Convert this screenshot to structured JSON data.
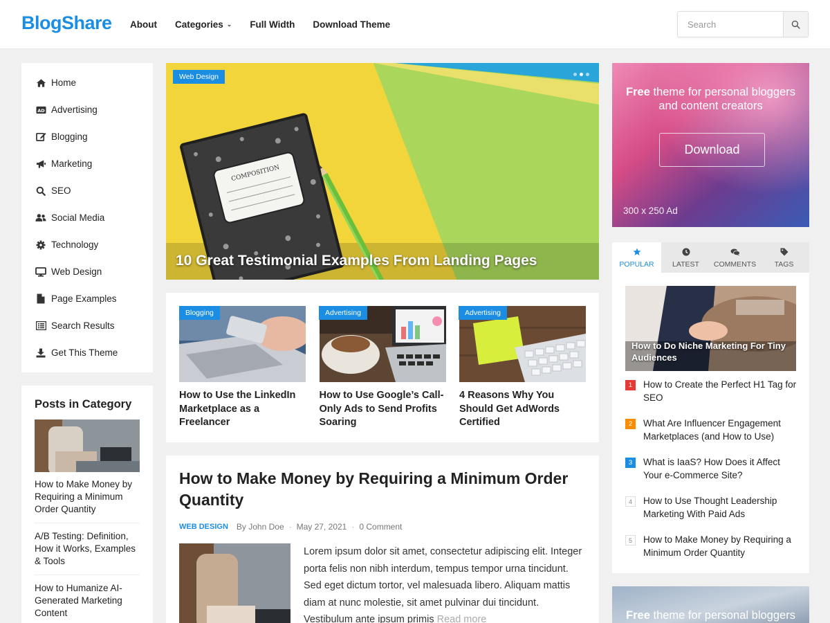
{
  "header": {
    "logo": "BlogShare",
    "nav": [
      {
        "label": "About",
        "dropdown": false
      },
      {
        "label": "Categories",
        "dropdown": true
      },
      {
        "label": "Full Width",
        "dropdown": false
      },
      {
        "label": "Download Theme",
        "dropdown": false
      }
    ],
    "search_placeholder": "Search"
  },
  "sidebar_menu": [
    {
      "label": "Home",
      "icon": "home-icon"
    },
    {
      "label": "Advertising",
      "icon": "ad-icon"
    },
    {
      "label": "Blogging",
      "icon": "edit-icon"
    },
    {
      "label": "Marketing",
      "icon": "megaphone-icon"
    },
    {
      "label": "SEO",
      "icon": "search-icon"
    },
    {
      "label": "Social Media",
      "icon": "users-icon"
    },
    {
      "label": "Technology",
      "icon": "gear-icon"
    },
    {
      "label": "Web Design",
      "icon": "monitor-icon"
    },
    {
      "label": "Page Examples",
      "icon": "file-icon"
    },
    {
      "label": "Search Results",
      "icon": "list-icon"
    },
    {
      "label": "Get This Theme",
      "icon": "download-icon"
    }
  ],
  "posts_in_category": {
    "title": "Posts in Category",
    "posts": [
      "How to Make Money by Requiring a Minimum Order Quantity",
      "A/B Testing: Definition, How it Works, Examples & Tools",
      "How to Humanize AI-Generated Marketing Content"
    ]
  },
  "hero": {
    "category": "Web Design",
    "title": "10 Great Testimonial Examples From Landing Pages",
    "notebook_label": "COMPOSITION"
  },
  "cards": [
    {
      "category": "Blogging",
      "title": "How to Use the LinkedIn Marketplace as a Freelancer"
    },
    {
      "category": "Advertising",
      "title": "How to Use Google’s Call-Only Ads to Send Profits Soaring"
    },
    {
      "category": "Advertising",
      "title": "4 Reasons Why You Should Get AdWords Certified"
    }
  ],
  "article": {
    "title": "How to Make Money by Requiring a Minimum Order Quantity",
    "category": "WEB DESIGN",
    "author": "By John Doe",
    "date": "May 27, 2021",
    "comments": "0 Comment",
    "excerpt": "Lorem ipsum dolor sit amet, consectetur adipiscing elit. Integer porta felis non nibh interdum, tempus tempor urna tincidunt. Sed eget dictum tortor, vel malesuada libero. Aliquam mattis diam at nunc molestie, sit amet pulvinar dui tincidunt. Vestibulum ante ipsum primis",
    "read_more": "Read more"
  },
  "ad": {
    "free": "Free",
    "text_line1": " theme for personal bloggers",
    "text_line2": "and content creators",
    "button": "Download",
    "size": "300 x 250 Ad"
  },
  "tabs": {
    "items": [
      {
        "label": "POPULAR",
        "icon": "star-icon",
        "active": true
      },
      {
        "label": "LATEST",
        "icon": "clock-icon",
        "active": false
      },
      {
        "label": "COMMENTS",
        "icon": "comments-icon",
        "active": false
      },
      {
        "label": "TAGS",
        "icon": "tag-icon",
        "active": false
      }
    ],
    "featured_title": "How to Do Niche Marketing For Tiny Audiences",
    "popular": [
      {
        "num": "1",
        "title": "How to Create the Perfect H1 Tag for SEO",
        "color": "#e53935"
      },
      {
        "num": "2",
        "title": "What Are Influencer Engagement Marketplaces (and How to Use)",
        "color": "#fb8c00"
      },
      {
        "num": "3",
        "title": "What is IaaS? How Does it Affect Your e-Commerce Site?",
        "color": "#1b8ee3"
      },
      {
        "num": "4",
        "title": "How to Use Thought Leadership Marketing With Paid Ads",
        "color": ""
      },
      {
        "num": "5",
        "title": "How to Make Money by Requiring a Minimum Order Quantity",
        "color": ""
      }
    ]
  },
  "ad2": {
    "free": "Free",
    "text_line1": " theme for personal bloggers"
  },
  "colors": {
    "accent": "#1b8ee3"
  }
}
